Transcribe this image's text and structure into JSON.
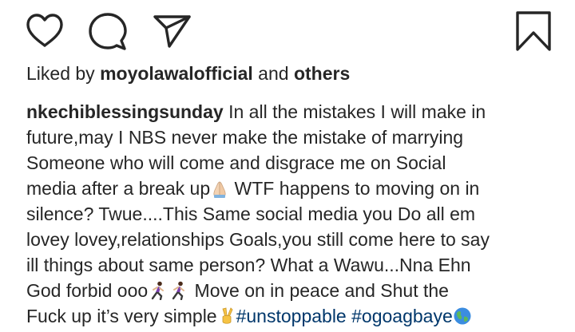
{
  "actions": {
    "like_icon": "heart-icon",
    "comment_icon": "comment-icon",
    "share_icon": "share-icon",
    "save_icon": "bookmark-icon"
  },
  "likes": {
    "prefix": "Liked by ",
    "user": "moyolawalofficial",
    "middle": " and ",
    "others": "others"
  },
  "caption": {
    "username": "nkechiblessingsunday",
    "line1": " In all the mistakes I will make in",
    "line2": "future,may I NBS never make the mistake of marrying",
    "line3": "Someone who will come and disgrace me on Social",
    "line4a": "media after a break up",
    "line4b": " WTF happens to moving on in",
    "line5": "silence? Twue....This Same social media you Do all em",
    "line6": "lovey lovey,relationships Goals,you still come here to say",
    "line7": "ill things about same person? What a Wawu...Nna Ehn",
    "line8a": "God forbid ooo",
    "line8b": " Move on in peace and Shut the",
    "line9a": "Fuck up it’s very simple",
    "hashtag1": "#unstoppable",
    "hashtag2": "#ogoagbaye",
    "emojis": [
      "folded-hands-emoji",
      "woman-running-emoji",
      "woman-running-emoji",
      "victory-hand-emoji",
      "globe-emoji"
    ]
  },
  "colors": {
    "text": "#262626",
    "hashtag": "#00376b",
    "background": "#ffffff"
  }
}
